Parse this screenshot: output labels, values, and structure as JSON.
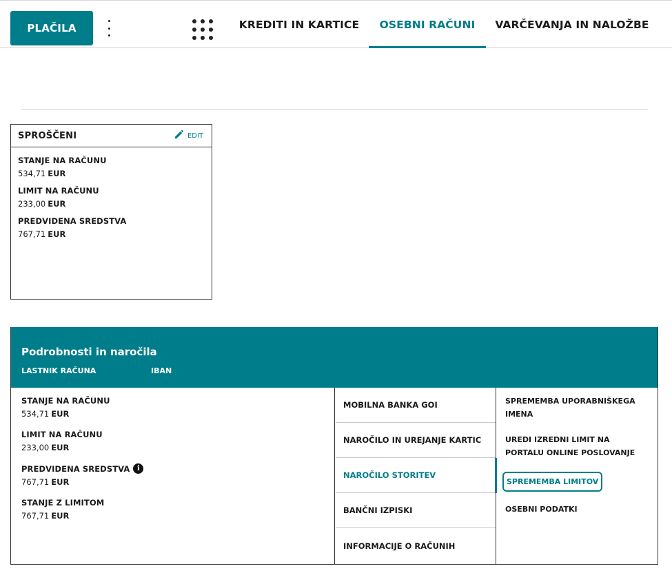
{
  "topbar": {
    "placila_label": "PLAČILA",
    "tabs": [
      {
        "label": "KREDITI IN KARTICE"
      },
      {
        "label": "OSEBNI RAČUNI"
      },
      {
        "label": "VARČEVANJA IN NALOŽBE"
      }
    ],
    "active_tab": "OSEBNI RAČUNI"
  },
  "card": {
    "title": "SPROŠČENI",
    "edit_label": "EDIT",
    "items": [
      {
        "label": "STANJE NA RAČUNU",
        "amount": "534,71",
        "currency": "EUR"
      },
      {
        "label": "LIMIT NA RAČUNU",
        "amount": "233,00",
        "currency": "EUR"
      },
      {
        "label": "PREDVIDENA SREDSTVA",
        "amount": "767,71",
        "currency": "EUR"
      }
    ]
  },
  "details": {
    "title": "Podrobnosti in naročila",
    "owner_label": "LASTNIK RAČUNA",
    "iban_label": "IBAN",
    "balances": [
      {
        "label": "STANJE NA RAČUNU",
        "amount": "534,71",
        "currency": "EUR"
      },
      {
        "label": "LIMIT NA RAČUNU",
        "amount": "233,00",
        "currency": "EUR"
      },
      {
        "label": "PREDVIDENA SREDSTVA",
        "amount": "767,71",
        "currency": "EUR"
      },
      {
        "label": "STANJE Z LIMITOM",
        "amount": "767,71",
        "currency": "EUR"
      }
    ],
    "menu": [
      {
        "label": "MOBILNA BANKA GOI"
      },
      {
        "label": "NAROČILO IN UREJANJE KARTIC"
      },
      {
        "label": "NAROČILO STORITEV"
      },
      {
        "label": "BANČNI IZPISKI"
      },
      {
        "label": "INFORMACIJE O RAČUNIH"
      }
    ],
    "active_menu": "NAROČILO STORITEV",
    "submenu": [
      {
        "label": "SPREMEMBA UPORABNIŠKEGA IMENA"
      },
      {
        "label": "UREDI IZREDNI LIMIT NA PORTALU ONLINE POSLOVANJE"
      },
      {
        "label": "SPREMEMBA LIMITOV"
      },
      {
        "label": "OSEBNI PODATKI"
      }
    ],
    "focused_submenu": "SPREMEMBA LIMITOV"
  },
  "colors": {
    "accent": "#007d8a",
    "text": "#1a1a1a",
    "border": "#333333"
  },
  "icons": {
    "kebab": "kebab-menu-icon",
    "apps": "apps-grid-icon",
    "edit": "pencil-icon",
    "info": "info-icon"
  }
}
